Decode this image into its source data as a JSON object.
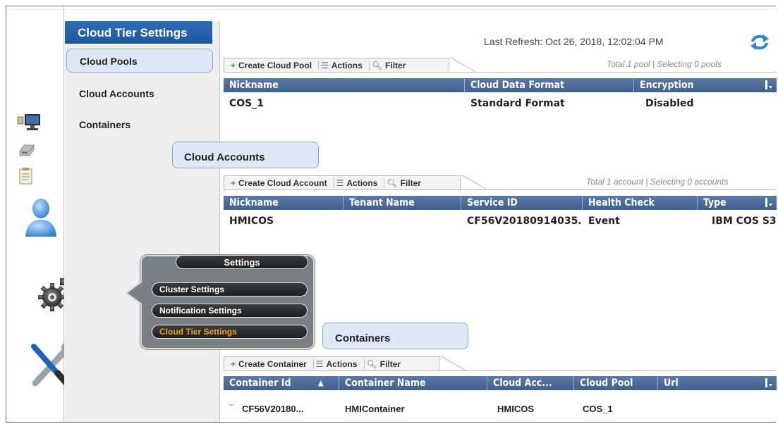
{
  "nav": {
    "title": "Cloud Tier Settings",
    "items": [
      {
        "label": "Cloud Pools",
        "selected": true
      },
      {
        "label": "Cloud Accounts",
        "selected": false
      },
      {
        "label": "Containers",
        "selected": false
      }
    ]
  },
  "header": {
    "last_refresh": "Last Refresh:  Oct 26, 2018, 12:02:04 PM",
    "refresh_icon": "refresh-icon"
  },
  "pools": {
    "toolbar": {
      "create": "Create Cloud Pool",
      "actions": "Actions",
      "filter": "Filter"
    },
    "summary": "Total 1 pool | Selecting 0 pools",
    "columns": [
      "Nickname",
      "Cloud Data Format",
      "Encryption"
    ],
    "rows": [
      [
        "COS_1",
        "Standard Format",
        "Disabled"
      ]
    ]
  },
  "accounts": {
    "section_label": "Cloud Accounts",
    "toolbar": {
      "create": "Create Cloud Account",
      "actions": "Actions",
      "filter": "Filter"
    },
    "summary": "Total 1 account | Selecting 0 accounts",
    "columns": [
      "Nickname",
      "Tenant Name",
      "Service ID",
      "Health Check",
      "Type"
    ],
    "rows": [
      [
        "HMICOS",
        "",
        "CF56V20180914035...",
        "Event",
        "IBM COS S3"
      ]
    ]
  },
  "containers": {
    "section_label": "Containers",
    "toolbar": {
      "create": "Create Container",
      "actions": "Actions",
      "filter": "Filter"
    },
    "columns": [
      "Container Id",
      "Container Name",
      "Cloud Acc...",
      "Cloud Pool",
      "Url"
    ],
    "rows": [
      [
        "CF56V20180...",
        "HMIContainer",
        "HMICOS",
        "COS_1",
        ""
      ]
    ]
  },
  "settings_menu": {
    "title": "Settings",
    "items": [
      "Cluster Settings",
      "Notification Settings",
      "Cloud Tier Settings"
    ],
    "active_item": "Cloud Tier Settings",
    "active_color": "#f0a11a"
  },
  "colors": {
    "accent": "#2f6db7",
    "table_header": "#4a6a97",
    "selection": "#dde8f6"
  }
}
